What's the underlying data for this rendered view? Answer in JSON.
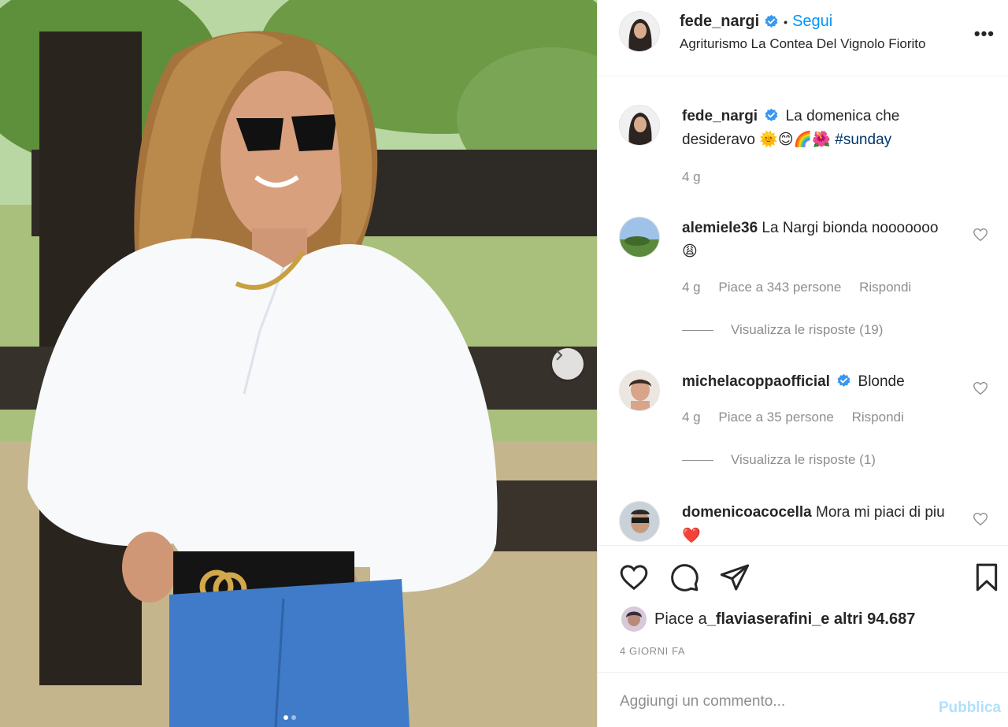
{
  "post": {
    "author": "fede_nargi",
    "follow_label": "Segui",
    "separator": "•",
    "location": "Agriturismo La Contea Del Vignolo Fiorito",
    "more_label": "•••"
  },
  "caption": {
    "username": "fede_nargi",
    "text": "La domenica che desideravo 🌞😊🌈🌺",
    "hashtag": "#sunday",
    "time": "4 g"
  },
  "comments": [
    {
      "username": "alemiele36",
      "text": "La Nargi bionda nooooooo 😩",
      "time": "4 g",
      "likes": "Piace a 343 persone",
      "reply_label": "Rispondi",
      "view_replies": "Visualizza le risposte (19)"
    },
    {
      "username": "michelacoppaofficial",
      "text": "Blonde",
      "time": "4 g",
      "likes": "Piace a 35 persone",
      "reply_label": "Rispondi",
      "view_replies": "Visualizza le risposte (1)"
    },
    {
      "username": "domenicoacocella",
      "text": "Mora mi piaci di piu❤️"
    }
  ],
  "likes_summary": {
    "prefix": "Piace a ",
    "user": "_flaviaserafini_",
    "suffix": " e altri 94.687"
  },
  "date_label": "4 GIORNI FA",
  "add_comment": {
    "placeholder": "Aggiungi un commento...",
    "publish_label": "Pubblica"
  },
  "icons": {
    "like": "heart-icon",
    "comment": "comment-bubble-icon",
    "share": "paper-plane-icon",
    "save": "bookmark-icon",
    "next": "chevron-right-icon",
    "verified": "verified-badge-icon"
  },
  "colors": {
    "accent": "#0095f6",
    "muted": "#8e8e8e",
    "text": "#262626",
    "publish_disabled": "#b2dffc"
  }
}
